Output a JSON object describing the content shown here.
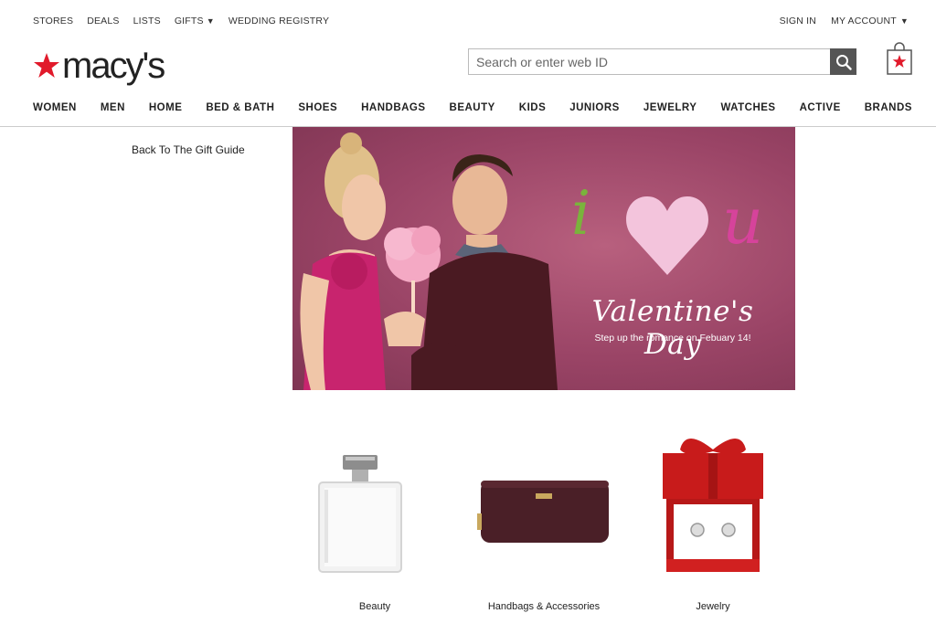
{
  "utility_nav": {
    "left": [
      {
        "label": "STORES",
        "caret": false
      },
      {
        "label": "DEALS",
        "caret": false
      },
      {
        "label": "LISTS",
        "caret": false
      },
      {
        "label": "GIFTS",
        "caret": true
      },
      {
        "label": "WEDDING REGISTRY",
        "caret": false
      }
    ],
    "right": [
      {
        "label": "SIGN IN",
        "caret": false
      },
      {
        "label": "MY ACCOUNT",
        "caret": true
      }
    ],
    "caret_glyph": "▼"
  },
  "logo": {
    "wordmark": "macy's",
    "star_color": "#e11a2b",
    "icon": "star-icon"
  },
  "search": {
    "placeholder": "Search or enter web ID",
    "value": "",
    "icon": "search-icon"
  },
  "bag": {
    "icon": "shopping-bag-icon"
  },
  "main_nav": [
    "WOMEN",
    "MEN",
    "HOME",
    "BED & BATH",
    "SHOES",
    "HANDBAGS",
    "BEAUTY",
    "KIDS",
    "JUNIORS",
    "JEWELRY",
    "WATCHES",
    "ACTIVE",
    "BRANDS"
  ],
  "back_link": "Back To The Gift Guide",
  "hero": {
    "i_letter": "i",
    "u_letter": "u",
    "title": "Valentine's Day",
    "tagline": "Step up the romance on Febuary 14!",
    "colors": {
      "background": "#9a4466",
      "i": "#7ab33c",
      "heart": "#f3c4dc",
      "u": "#d6439b"
    }
  },
  "categories": [
    {
      "label": "Beauty",
      "image": "perfume-bottle"
    },
    {
      "label": "Handbags & Accessories",
      "image": "wallet"
    },
    {
      "label": "Jewelry",
      "image": "gift-box-earrings"
    }
  ]
}
